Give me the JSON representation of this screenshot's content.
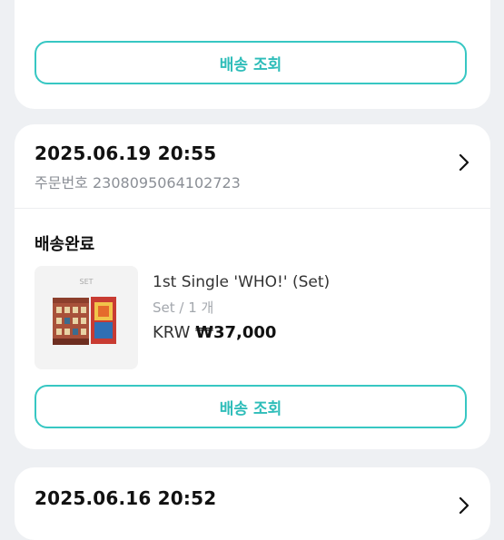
{
  "top_card": {
    "track_label": "배송 조회"
  },
  "order": {
    "date": "2025.06.19 20:55",
    "number_label": "주문번호",
    "number": "2308095064102723",
    "status": "배송완료",
    "product": {
      "thumb_label": "SET",
      "name": "1st Single 'WHO!' (Set)",
      "option": "Set / 1 개",
      "currency": "KRW",
      "price": "₩37,000"
    },
    "track_label": "배송 조회"
  },
  "next_order": {
    "date": "2025.06.16 20:52"
  }
}
